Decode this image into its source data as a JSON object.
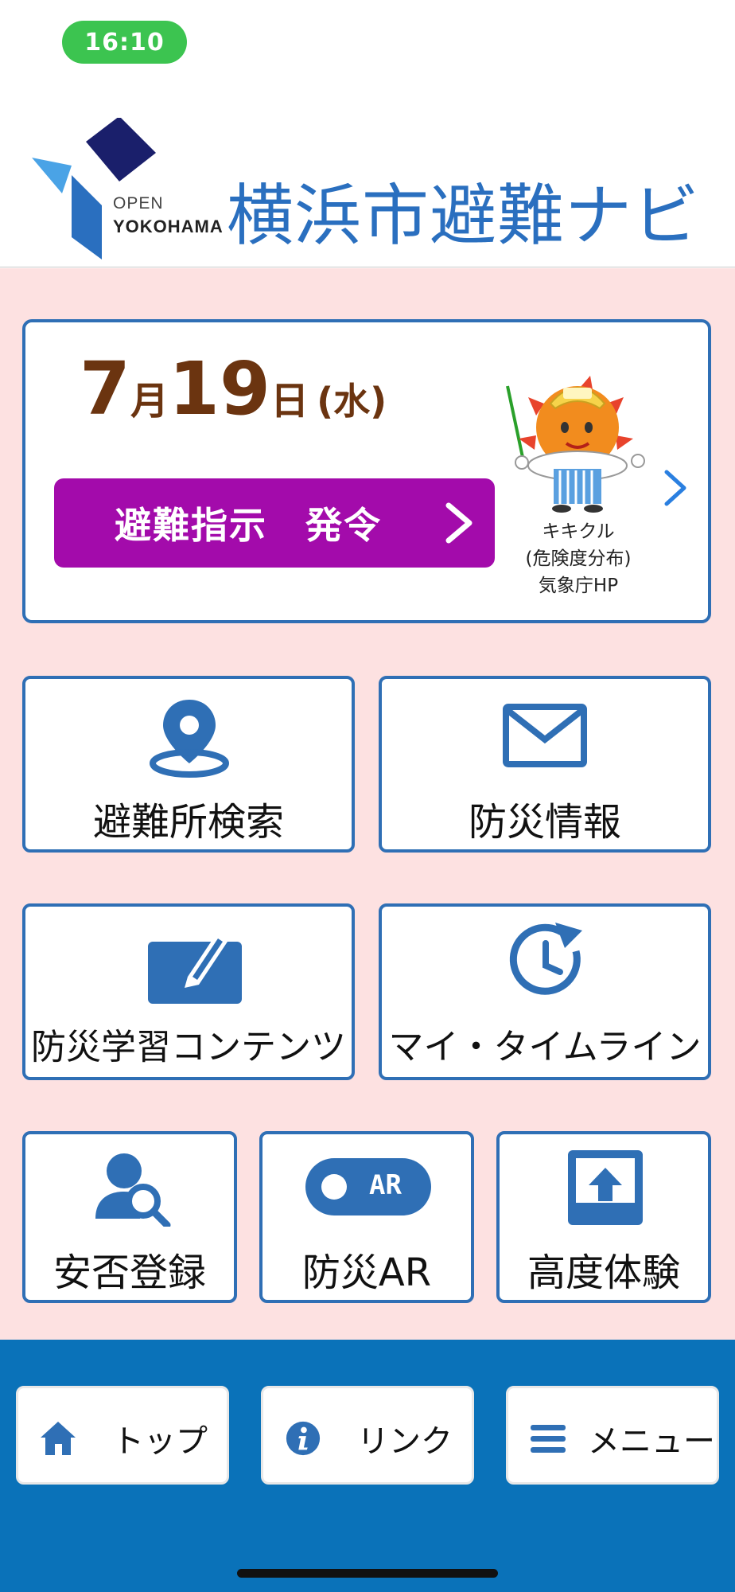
{
  "status_bar": {
    "time": "16:10"
  },
  "header": {
    "logo_open": "OPEN",
    "logo_city": "YOKOHAMA",
    "title": "横浜市避難ナビ"
  },
  "date_card": {
    "month": "7",
    "month_unit": "月",
    "day": "19",
    "day_unit": "日",
    "weekday": "(水)",
    "alert_label": "避難指示　発令",
    "mascot_caption_1": "キキクル",
    "mascot_caption_2": "(危険度分布)",
    "mascot_caption_3": "気象庁HP",
    "alert_color": "#a30bab"
  },
  "tiles": [
    {
      "label": "避難所検索",
      "icon": "map-pin-icon"
    },
    {
      "label": "防災情報",
      "icon": "envelope-icon"
    },
    {
      "label": "防災学習コンテンツ",
      "icon": "tablet-pen-icon"
    },
    {
      "label": "マイ・タイムライン",
      "icon": "clock-refresh-icon"
    },
    {
      "label": "安否登録",
      "icon": "person-search-icon"
    },
    {
      "label": "防災AR",
      "icon": "ar-toggle-icon"
    },
    {
      "label": "高度体験",
      "icon": "upload-box-icon"
    }
  ],
  "ar_badge": "AR",
  "bottom_nav": [
    {
      "label": "トップ",
      "icon": "home-icon"
    },
    {
      "label": "リンク",
      "icon": "info-icon"
    },
    {
      "label": "メニュー",
      "icon": "hamburger-icon"
    }
  ],
  "colors": {
    "accent": "#2f6fb5",
    "bottom_bar": "#0a72b9",
    "background": "#fde1e1",
    "date": "#6b3410"
  }
}
